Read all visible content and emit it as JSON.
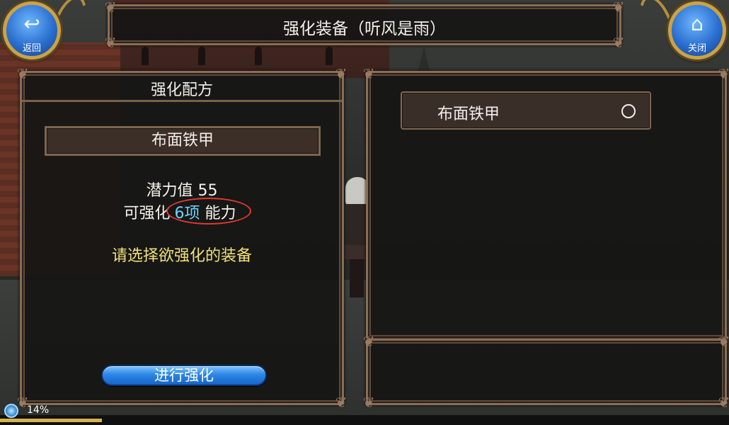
{
  "header": {
    "title": "强化装备（听风是雨）"
  },
  "nav": {
    "back_label": "返回",
    "close_label": "关闭"
  },
  "recipe": {
    "title": "强化配方",
    "selected_item": "布面铁甲",
    "potential_label": "潜力值",
    "potential_value": "55",
    "enhance_prefix": "可强化",
    "enhance_count": "6项",
    "enhance_suffix": "能力",
    "prompt": "请选择欲强化的装备",
    "enhance_button": "进行强化"
  },
  "equipment_list": [
    {
      "name": "布面铁甲",
      "selected": false
    }
  ],
  "status": {
    "progress_percent": 14,
    "progress_text": "14%"
  },
  "colors": {
    "enhance_count": "#6fd3ff",
    "prompt": "#f1e07a",
    "button_blue": "#2d86e6",
    "frame_gold": "#c9a348"
  }
}
